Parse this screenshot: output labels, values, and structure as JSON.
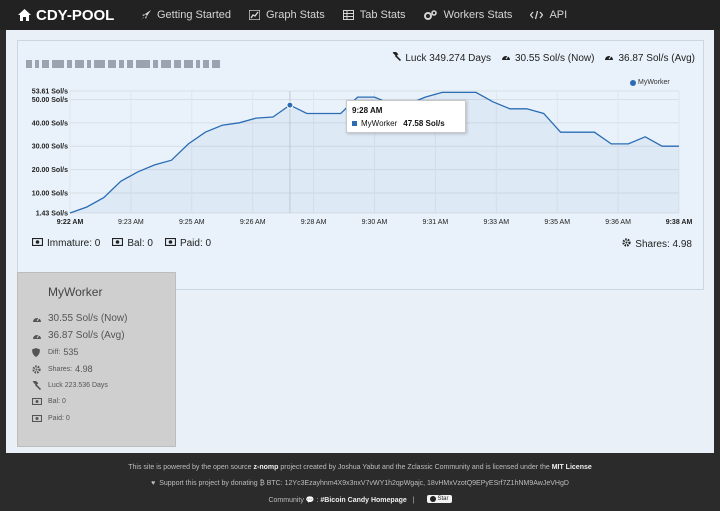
{
  "navbar": {
    "brand": "CDY-POOL",
    "items": [
      {
        "label": "Getting Started",
        "icon": "rocket-icon"
      },
      {
        "label": "Graph Stats",
        "icon": "chart-icon"
      },
      {
        "label": "Tab Stats",
        "icon": "table-icon"
      },
      {
        "label": "Workers Stats",
        "icon": "gears-icon"
      },
      {
        "label": "API",
        "icon": "code-icon"
      }
    ]
  },
  "stats": {
    "luck": "Luck 349.274 Days",
    "hashrate_now": "30.55 Sol/s (Now)",
    "hashrate_avg": "36.87 Sol/s (Avg)",
    "immature": "Immature: 0",
    "bal": "Bal: 0",
    "paid": "Paid: 0",
    "shares": "Shares: 4.98"
  },
  "tooltip": {
    "time": "9:28 AM",
    "series": "MyWorker",
    "value": "47.58 Sol/s"
  },
  "chart_data": {
    "type": "area",
    "series": [
      {
        "name": "MyWorker",
        "x": [
          "9:22 AM",
          "9:22 AM",
          "9:22 AM",
          "9:23 AM",
          "9:23 AM",
          "9:23 AM",
          "9:24 AM",
          "9:24 AM",
          "9:25 AM",
          "9:25 AM",
          "9:25 AM",
          "9:26 AM",
          "9:26 AM",
          "9:27 AM",
          "9:27 AM",
          "9:28 AM",
          "9:28 AM",
          "9:29 AM",
          "9:29 AM",
          "9:30 AM",
          "9:30 AM",
          "9:30 AM",
          "9:31 AM",
          "9:31 AM",
          "9:32 AM",
          "9:32 AM",
          "9:33 AM",
          "9:33 AM",
          "9:34 AM",
          "9:34 AM",
          "9:35 AM",
          "9:35 AM",
          "9:36 AM",
          "9:36 AM",
          "9:37 AM",
          "9:37 AM",
          "9:38 AM"
        ],
        "values": [
          1.43,
          4,
          8,
          15,
          19,
          22,
          24,
          31,
          36,
          39,
          40,
          42,
          42.5,
          47.58,
          44,
          44,
          44,
          51,
          51,
          48,
          48,
          51,
          53,
          53,
          53,
          49,
          46,
          46,
          44,
          36,
          36,
          36,
          31,
          31,
          34,
          30,
          30
        ]
      }
    ],
    "y_ticks": [
      "1.43 Sol/s",
      "10.00 Sol/s",
      "20.00 Sol/s",
      "30.00 Sol/s",
      "40.00 Sol/s",
      "50.00 Sol/s",
      "53.61 Sol/s"
    ],
    "y_tick_values": [
      1.43,
      10,
      20,
      30,
      40,
      50,
      53.61
    ],
    "ylim": [
      1.43,
      53.61
    ],
    "x_ticks": [
      "9:22 AM",
      "9:23 AM",
      "9:25 AM",
      "9:26 AM",
      "9:28 AM",
      "9:30 AM",
      "9:31 AM",
      "9:33 AM",
      "9:35 AM",
      "9:36 AM",
      "9:38 AM"
    ],
    "grid": true,
    "legend": "top-right",
    "color": "#2b6cb5"
  },
  "worker": {
    "name": "MyWorker",
    "rows": [
      {
        "label": "30.55 Sol/s (Now)",
        "icon": "tachometer-icon"
      },
      {
        "label": "36.87 Sol/s (Avg)",
        "icon": "tachometer-icon"
      },
      {
        "label": "Diff: ",
        "value": "535",
        "icon": "shield-icon"
      },
      {
        "label": "Shares: ",
        "value": "4.98",
        "icon": "gear-icon"
      },
      {
        "label": "Luck 223.536 Days",
        "icon": "gavel-icon"
      },
      {
        "label": "Bal: 0",
        "icon": "money-icon"
      },
      {
        "label": "Paid: 0",
        "icon": "money-icon"
      }
    ]
  },
  "footer": {
    "line1_pre": "This site is powered by the open source ",
    "line1_bold1": "z-nomp",
    "line1_mid": " project created by Joshua Yabut and the Zclassic Community and is licensed under the ",
    "line1_bold2": "MIT License",
    "line2": "Support this project by donating ₿ BTC: 12Yc3Ezayhnm4X9x3nxV7vWY1h2qpWgajc, 18vHMxVzotQ9EPyESrf7Z1hNM9AwJeVHgD",
    "line3_pre": "Community",
    "line3_link": "#Bicoin Candy Homepage",
    "star": "Star"
  }
}
